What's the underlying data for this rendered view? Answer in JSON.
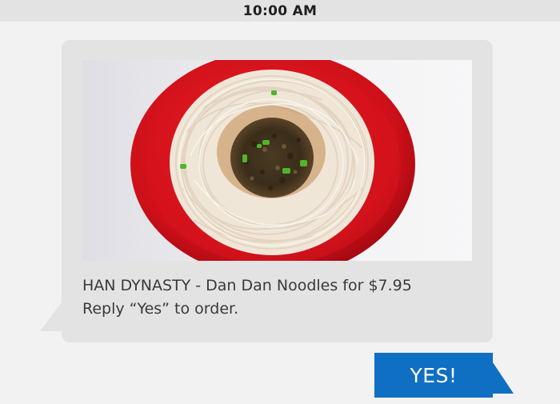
{
  "status_bar": {
    "time": "10:00 AM"
  },
  "incoming_message": {
    "image_subject": "Dan Dan Noodles in red bowl",
    "lines": [
      "HAN DYNASTY - Dan Dan Noodles for $7.95",
      "Reply “Yes” to order."
    ]
  },
  "outgoing_message": {
    "text": "YES!"
  },
  "colors": {
    "bubble_incoming": "#e3e3e3",
    "bubble_outgoing": "#0f6fc2",
    "bowl_red": "#d8161f",
    "background": "#f2f2f2"
  }
}
